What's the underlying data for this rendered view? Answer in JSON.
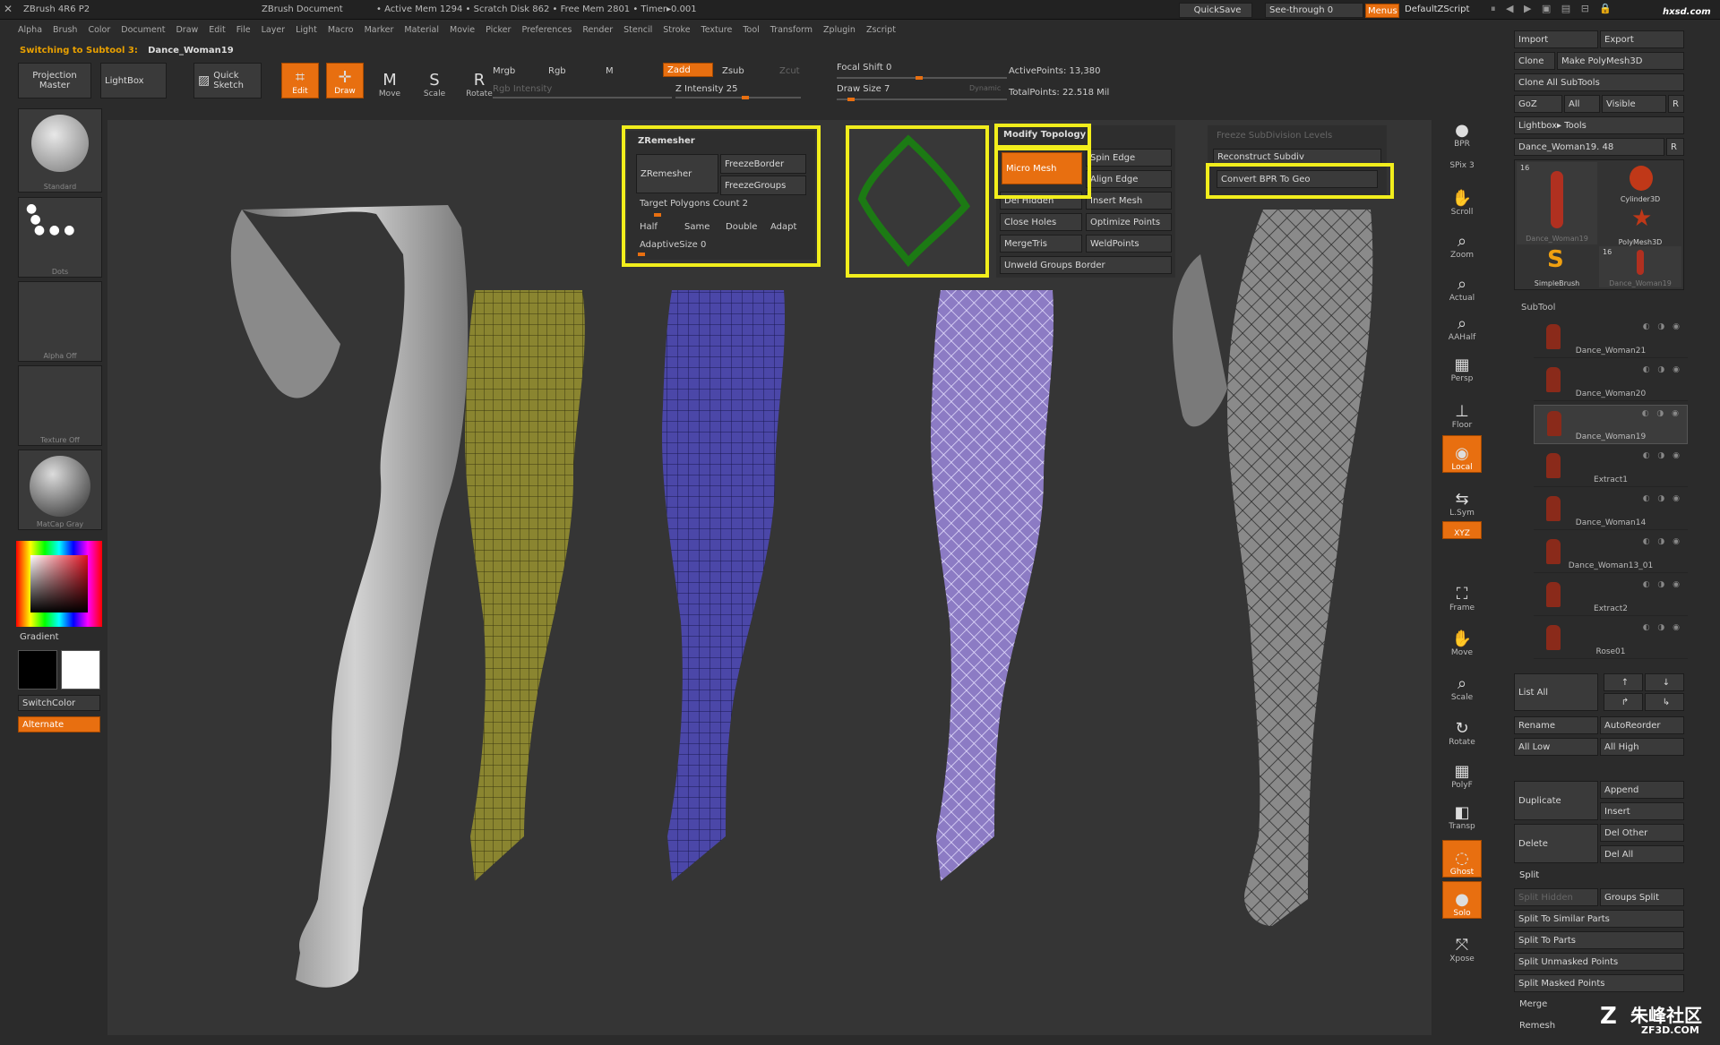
{
  "titlebar": {
    "app": "ZBrush 4R6 P2",
    "doc": "ZBrush Document",
    "stats": "• Active Mem 1294 • Scratch Disk 862 • Free Mem 2801 • Timer▸0.001",
    "quicksave": "QuickSave",
    "seethrough": "See-through  0",
    "menus": "Menus",
    "script": "DefaultZScript",
    "watermark_top": "hxsd.com"
  },
  "menubar": [
    "Alpha",
    "Brush",
    "Color",
    "Document",
    "Draw",
    "Edit",
    "File",
    "Layer",
    "Light",
    "Macro",
    "Marker",
    "Material",
    "Movie",
    "Picker",
    "Preferences",
    "Render",
    "Stencil",
    "Stroke",
    "Texture",
    "Tool",
    "Transform",
    "Zplugin",
    "Zscript"
  ],
  "notice": {
    "prefix": "Switching to Subtool 3:",
    "name": "Dance_Woman19"
  },
  "toolbar": {
    "projection_master": "Projection Master",
    "lightbox": "LightBox",
    "quick_sketch": "Quick Sketch",
    "edit": "Edit",
    "draw": "Draw",
    "move": "Move",
    "scale": "Scale",
    "rotate": "Rotate",
    "mrgb": "Mrgb",
    "rgb": "Rgb",
    "m": "M",
    "rgb_intensity": "Rgb Intensity",
    "zadd": "Zadd",
    "zsub": "Zsub",
    "zcut": "Zcut",
    "z_intensity": "Z Intensity 25",
    "focal_shift": "Focal Shift 0",
    "draw_size": "Draw Size 7",
    "dynamic": "Dynamic",
    "active_points": "ActivePoints: 13,380",
    "total_points": "TotalPoints: 22.518 Mil"
  },
  "leftshelf": {
    "brush": "Standard",
    "stroke": "Dots",
    "alpha": "Alpha  Off",
    "texture": "Texture  Off",
    "material": "MatCap  Gray",
    "gradient": "Gradient",
    "switchcolor": "SwitchColor",
    "alternate": "Alternate"
  },
  "zremesher_panel": {
    "title": "ZRemesher",
    "zremesher": "ZRemesher",
    "freezeborder": "FreezeBorder",
    "freezegroups": "FreezeGroups",
    "target": "Target Polygons Count 2",
    "half": "Half",
    "same": "Same",
    "double": "Double",
    "adapt": "Adapt",
    "adaptivesize": "AdaptiveSize 0"
  },
  "topology_panel": {
    "title": "Modify Topology",
    "micro_mesh": "Micro Mesh",
    "spin_edge": "Spin Edge",
    "align_edge": "Align Edge",
    "del_hidden": "Del Hidden",
    "insert_mesh": "Insert Mesh",
    "close_holes": "Close Holes",
    "optimize_points": "Optimize Points",
    "mergetris": "MergeTris",
    "weldpoints": "WeldPoints",
    "unweld": "Unweld Groups Border"
  },
  "subdiv_panel": {
    "freeze": "Freeze SubDivision Levels",
    "reconstruct": "Reconstruct Subdiv",
    "convert": "Convert BPR To Geo"
  },
  "righttools": [
    "BPR",
    "SPix 3",
    "Scroll",
    "Zoom",
    "Actual",
    "AAHalf",
    "Persp",
    "Floor",
    "Local",
    "L.Sym",
    "XYZ",
    "Frame",
    "Move",
    "Scale",
    "Rotate",
    "PolyF",
    "Transp",
    "Ghost",
    "Solo",
    "Xpose"
  ],
  "toolpanel": {
    "import": "Import",
    "export": "Export",
    "clone": "Clone",
    "make_polymesh": "Make PolyMesh3D",
    "clone_all": "Clone  All SubTools",
    "goz": "GoZ",
    "all": "All",
    "visible": "Visible",
    "r": "R",
    "lightbox_tools": "Lightbox▸ Tools",
    "current_tool": "Dance_Woman19. 48",
    "thumbs": [
      "Dance_Woman19",
      "Cylinder3D",
      "PolyMesh3D",
      "SimpleBrush",
      "Dance_Woman19"
    ],
    "thumb_counts": [
      "16",
      "16"
    ],
    "subtool_header": "SubTool",
    "subtools": [
      "Dance_Woman21",
      "Dance_Woman20",
      "Dance_Woman19",
      "Extract1",
      "Dance_Woman14",
      "Dance_Woman13_01",
      "Extract2",
      "Rose01"
    ],
    "list_all": "List  All",
    "rename": "Rename",
    "autoreorder": "AutoReorder",
    "all_low": "All  Low",
    "all_high": "All  High",
    "duplicate": "Duplicate",
    "append": "Append",
    "insert": "Insert",
    "delete": "Delete",
    "del_other": "Del  Other",
    "del_all": "Del  All",
    "split_header": "Split",
    "split_hidden": "Split  Hidden",
    "groups_split": "Groups  Split",
    "split_similar": "Split  To  Similar  Parts",
    "split_parts": "Split  To  Parts",
    "split_unmasked": "Split  Unmasked  Points",
    "split_masked": "Split  Masked  Points",
    "merge": "Merge",
    "remesh": "Remesh"
  },
  "watermark": {
    "cn": "朱峰社区",
    "url": "ZF3D.COM"
  },
  "colors": {
    "accent": "#e86f10",
    "highlight": "#f2ee1c",
    "bg": "#2b2b2b",
    "canvas": "#333333"
  }
}
